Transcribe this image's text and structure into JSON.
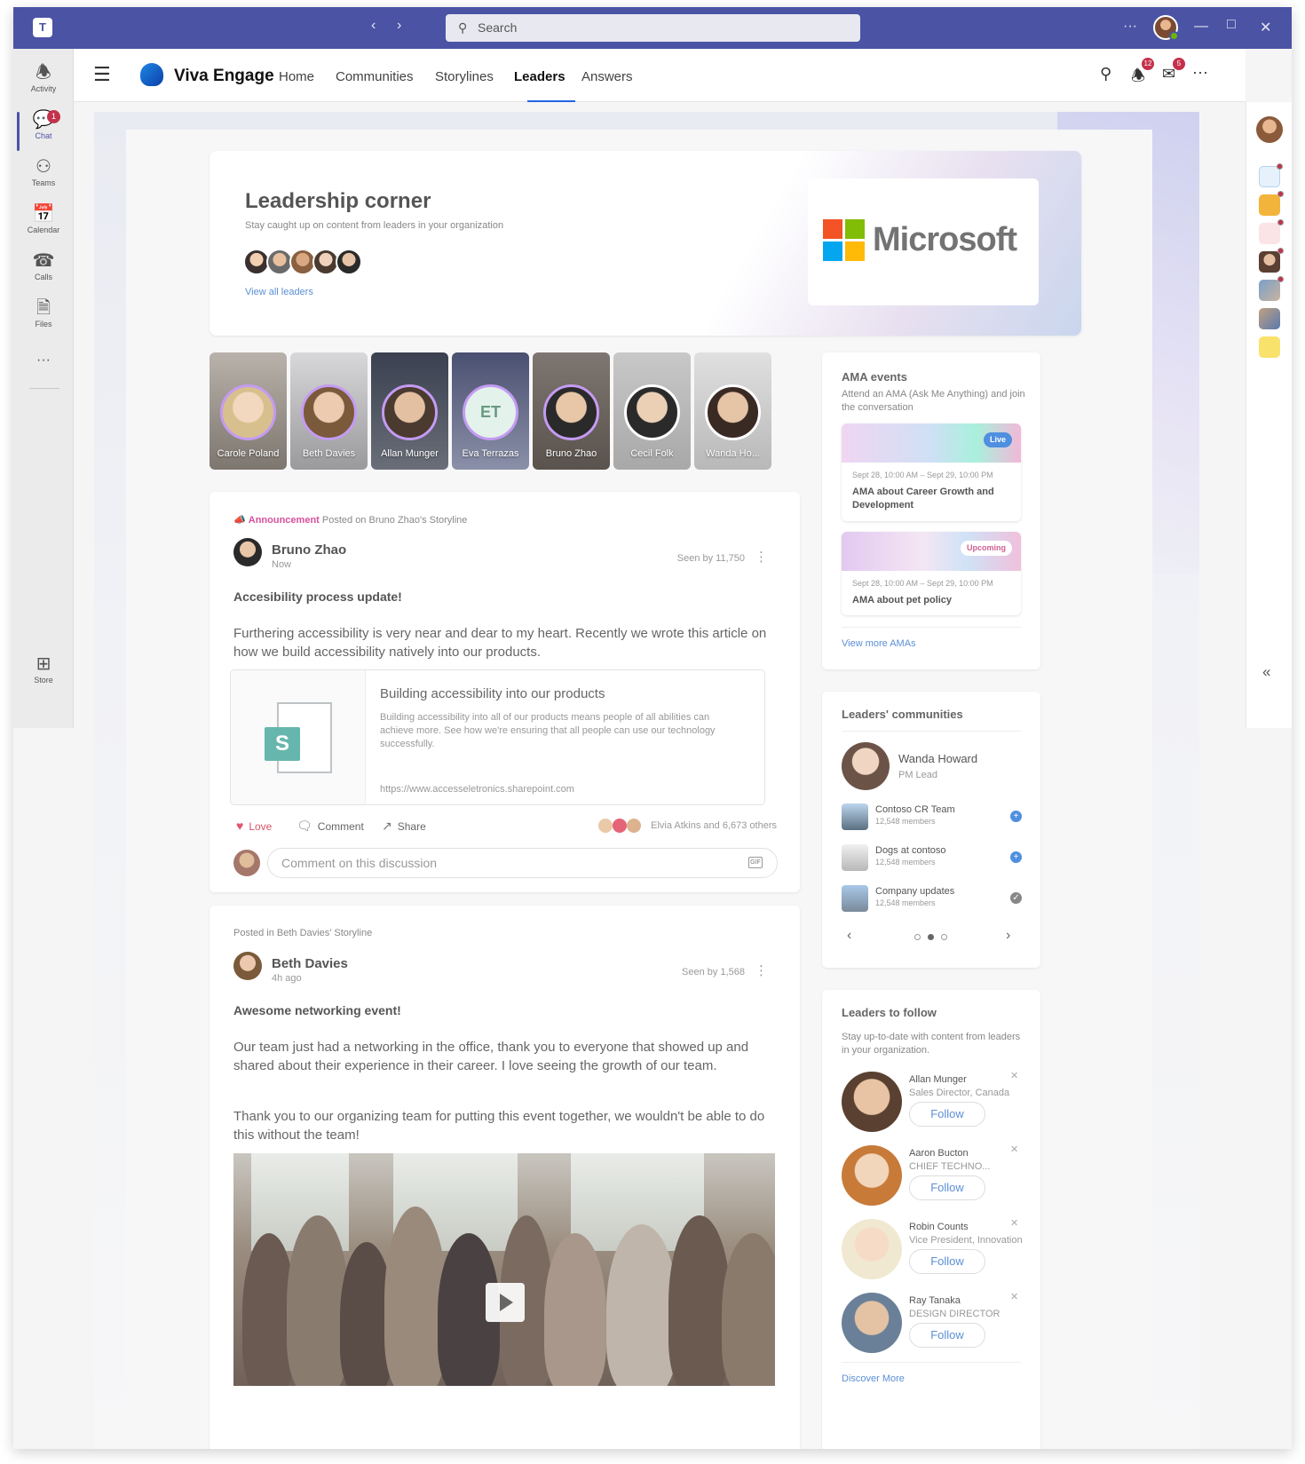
{
  "titlebar": {
    "search_placeholder": "Search"
  },
  "rail": {
    "items": [
      {
        "label": "Activity",
        "icon": "bell-icon"
      },
      {
        "label": "Chat",
        "icon": "chat-icon",
        "badge": "1"
      },
      {
        "label": "Teams",
        "icon": "teams-icon"
      },
      {
        "label": "Calendar",
        "icon": "calendar-icon"
      },
      {
        "label": "Calls",
        "icon": "phone-icon"
      },
      {
        "label": "Files",
        "icon": "file-icon"
      },
      {
        "label": "Store",
        "icon": "store-icon"
      }
    ]
  },
  "header": {
    "brand": "Viva Engage",
    "nav": [
      "Home",
      "Communities",
      "Storylines",
      "Leaders",
      "Answers"
    ],
    "active_nav": "Leaders",
    "notifications_badge": "12",
    "inbox_badge": "5"
  },
  "hero": {
    "title": "Leadership corner",
    "subtitle": "Stay caught up on content from leaders in your organization",
    "link": "View all leaders",
    "logo_text": "Microsoft"
  },
  "leaders": [
    {
      "name": "Carole Poland"
    },
    {
      "name": "Beth Davies"
    },
    {
      "name": "Allan Munger"
    },
    {
      "name": "Eva Terrazas",
      "initials": "ET"
    },
    {
      "name": "Bruno Zhao"
    },
    {
      "name": "Cecil Folk"
    },
    {
      "name": "Wanda Ho..."
    }
  ],
  "post1": {
    "tag": "Announcement",
    "meta": "Posted on Bruno Zhao's Storyline",
    "author": "Bruno Zhao",
    "time": "Now",
    "seen": "Seen by 11,750",
    "title": "Accesibility process update!",
    "body": "Furthering accessibility is very near and dear to my heart. Recently we wrote this article on how we build accessibility natively into our products.",
    "link_title": "Building accessibility into our products",
    "link_desc": "Building accessibility into all of our products means people of all abilities can achieve more. See how we're ensuring that all people can use our technology successfully.",
    "link_url": "https://www.accesseletronics.sharepoint.com",
    "love": "Love",
    "comment": "Comment",
    "share": "Share",
    "reactions": "Elvia Atkins and 6,673 others",
    "comment_placeholder": "Comment on this discussion",
    "gif": "GIF"
  },
  "post2": {
    "meta": "Posted in Beth Davies' Storyline",
    "author": "Beth Davies",
    "time": "4h ago",
    "seen": "Seen by 1,568",
    "title": "Awesome networking event!",
    "body1": "Our team just had a networking in the office, thank you to everyone that showed up and shared about their experience in their career. I love seeing the growth of our team.",
    "body2": "Thank you to our organizing team for putting this event together, we wouldn't be able to do this without the team!"
  },
  "ama": {
    "title": "AMA events",
    "subtitle": "Attend an AMA (Ask Me Anything) and join the conversation",
    "events": [
      {
        "status": "Live",
        "date": "Sept 28, 10:00 AM – Sept 29, 10:00 PM",
        "title": "AMA about Career Growth and Development"
      },
      {
        "status": "Upcoming",
        "date": "Sept 28, 10:00 AM – Sept 29, 10:00 PM",
        "title": "AMA about pet policy"
      }
    ],
    "more": "View more AMAs"
  },
  "communities": {
    "title": "Leaders' communities",
    "leader_name": "Wanda Howard",
    "leader_role": "PM Lead",
    "items": [
      {
        "name": "Contoso CR Team",
        "members": "12,548 members",
        "joined": false
      },
      {
        "name": "Dogs at contoso",
        "members": "12,548 members",
        "joined": false
      },
      {
        "name": "Company updates",
        "members": "12,548 members",
        "joined": true
      }
    ],
    "active_page": 2,
    "pages": 3
  },
  "follow": {
    "title": "Leaders to follow",
    "subtitle": "Stay up-to-date with content from leaders in your organization.",
    "button": "Follow",
    "items": [
      {
        "name": "Allan Munger",
        "role": "Sales Director, Canada"
      },
      {
        "name": "Aaron Bucton",
        "role": "CHIEF TECHNO..."
      },
      {
        "name": "Robin Counts",
        "role": "Vice President, Innovation"
      },
      {
        "name": "Ray Tanaka",
        "role": "DESIGN DIRECTOR"
      }
    ],
    "more": "Discover More"
  },
  "colors": {
    "teams_purple": "#4b53a5",
    "accent_blue": "#2266e3",
    "announcement_pink": "#d6519a",
    "badge_red": "#c4314b"
  }
}
